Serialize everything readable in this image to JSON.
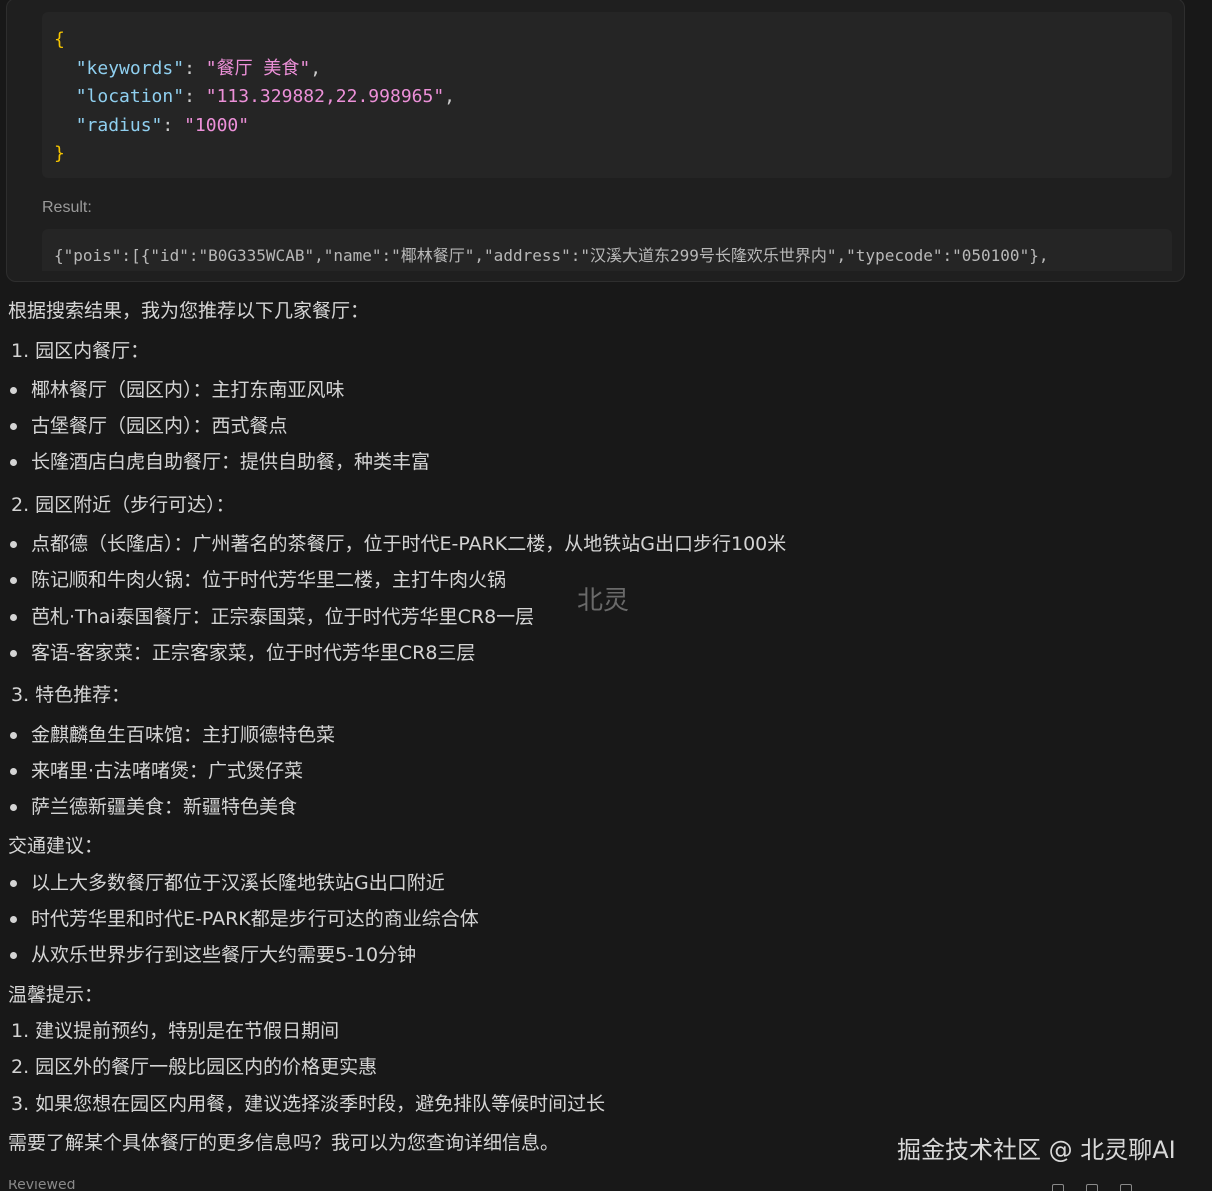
{
  "tool_call": {
    "args_json": {
      "open_brace": "{",
      "close_brace": "}",
      "k1": "\"keywords\"",
      "v1": "\"餐厅 美食\"",
      "k2": "\"location\"",
      "v2": "\"113.329882,22.998965\"",
      "k3": "\"radius\"",
      "v3": "\"1000\""
    },
    "result_label": "Result:",
    "result_text": "{\"pois\":[{\"id\":\"B0G335WCAB\",\"name\":\"椰林餐厅\",\"address\":\"汉溪大道东299号长隆欢乐世界内\",\"typecode\":\"050100\"},"
  },
  "response": {
    "intro": "根据搜索结果，我为您推荐以下几家餐厅：",
    "sec1_title": "1. 园区内餐厅：",
    "sec1_items": [
      "椰林餐厅（园区内）：主打东南亚风味",
      "古堡餐厅（园区内）：西式餐点",
      "长隆酒店白虎自助餐厅：提供自助餐，种类丰富"
    ],
    "sec2_title": "2. 园区附近（步行可达）：",
    "sec2_items": [
      "点都德（长隆店）：广州著名的茶餐厅，位于时代E-PARK二楼，从地铁站G出口步行100米",
      "陈记顺和牛肉火锅：位于时代芳华里二楼，主打牛肉火锅",
      "芭札·Thai泰国餐厅：正宗泰国菜，位于时代芳华里CR8一层",
      "客语-客家菜：正宗客家菜，位于时代芳华里CR8三层"
    ],
    "sec3_title": "3. 特色推荐：",
    "sec3_items": [
      "金麒麟鱼生百味馆：主打顺德特色菜",
      "来啫里·古法啫啫煲：广式煲仔菜",
      "萨兰德新疆美食：新疆特色美食"
    ],
    "traffic_title": "交通建议：",
    "traffic_items": [
      "以上大多数餐厅都位于汉溪长隆地铁站G出口附近",
      "时代芳华里和时代E-PARK都是步行可达的商业综合体",
      "从欢乐世界步行到这些餐厅大约需要5-10分钟"
    ],
    "tips_title": "温馨提示：",
    "tips_items": [
      "1. 建议提前预约，特别是在节假日期间",
      "2. 园区外的餐厅一般比园区内的价格更实惠",
      "3. 如果您想在园区内用餐，建议选择淡季时段，避免排队等候时间过长"
    ],
    "closing": "需要了解某个具体餐厅的更多信息吗？我可以为您查询详细信息。"
  },
  "watermark": "北灵",
  "brand_watermark": "掘金技术社区 @ 北灵聊AI",
  "footer_fragment": "Reviewed"
}
